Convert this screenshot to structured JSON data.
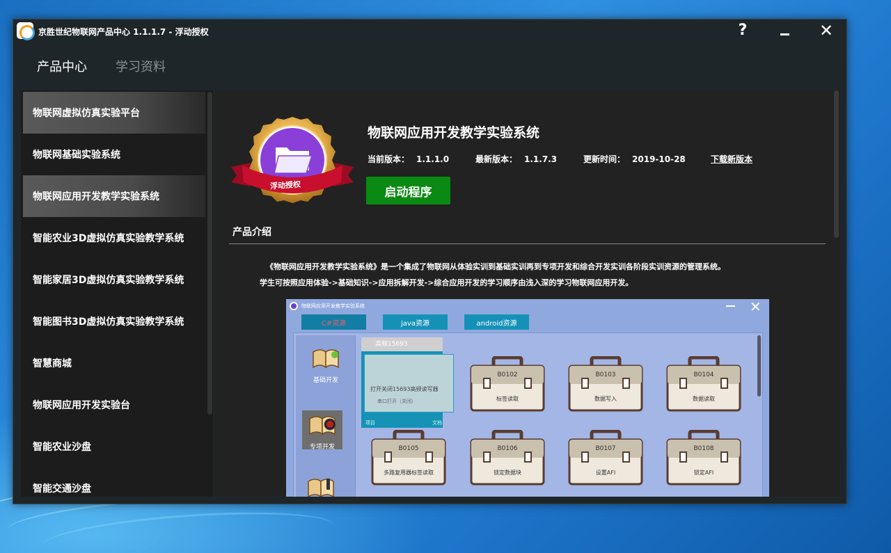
{
  "window": {
    "title": "京胜世纪物联网产品中心 1.1.1.7 - 浮动授权",
    "help_symbol": "?",
    "close_symbol": "✕"
  },
  "topnav": {
    "items": [
      {
        "label": "产品中心",
        "active": true
      },
      {
        "label": "学习资料",
        "active": false
      }
    ]
  },
  "sidebar": {
    "items": [
      {
        "label": "物联网虚拟仿真实验平台",
        "selected": true
      },
      {
        "label": "物联网基础实验系统",
        "selected": false
      },
      {
        "label": "物联网应用开发教学实验系统",
        "selected": true
      },
      {
        "label": "智能农业3D虚拟仿真实验教学系统",
        "selected": false
      },
      {
        "label": "智能家居3D虚拟仿真实验教学系统",
        "selected": false
      },
      {
        "label": "智能图书3D虚拟仿真实验教学系统",
        "selected": false
      },
      {
        "label": "智慧商城",
        "selected": false
      },
      {
        "label": "物联网应用开发实验台",
        "selected": false
      },
      {
        "label": "智能农业沙盘",
        "selected": false
      },
      {
        "label": "智能交通沙盘",
        "selected": false
      }
    ]
  },
  "product": {
    "badge_label": "浮动授权",
    "title": "物联网应用开发教学实验系统",
    "current_version_label": "当前版本：",
    "current_version": "1.1.1.0",
    "latest_version_label": "最新版本：",
    "latest_version": "1.1.7.3",
    "updated_label": "更新时间：",
    "updated": "2019-10-28",
    "download_label": "下载新版本",
    "launch_label": "启动程序",
    "intro_title": "产品介绍",
    "intro_line1": "《物联网应用开发教学实验系统》是一个集成了物联网从体验实训到基础实训再到专项开发和综合开发实训各阶段实训资源的管理系统。",
    "intro_line2": "学生可按照应用体验->基础知识->应用拆解开发->综合应用开发的学习顺序由浅入深的学习物联网应用开发。"
  },
  "screenshot": {
    "title": "物联网应用开发教学实验系统",
    "tabs": [
      "C#资源",
      "java资源",
      "android资源"
    ],
    "nav": [
      "基础开发",
      "专项开发"
    ],
    "panel_title": "高频15693",
    "panel_text": "打开关闭15693高频读写器",
    "panel_sub": "串口打开（关闭）",
    "panel_foot_left": "项目",
    "panel_foot_right": "文档",
    "cases": [
      {
        "code": "B0102",
        "name": "标签读取"
      },
      {
        "code": "B0103",
        "name": "数据写入"
      },
      {
        "code": "B0104",
        "name": "数据读取"
      },
      {
        "code": "B0105",
        "name": "多路复用器标签读取"
      },
      {
        "code": "B0106",
        "name": "锁定数据块"
      },
      {
        "code": "B0107",
        "name": "设置AFI"
      },
      {
        "code": "B0108",
        "name": "锁定AFI"
      }
    ]
  },
  "colors": {
    "window_bg": "#1f262a",
    "launch_green": "#0a8a12",
    "badge_purple": "#8a3fd8",
    "badge_red": "#c8102e",
    "badge_gold": "#e6b04a"
  }
}
